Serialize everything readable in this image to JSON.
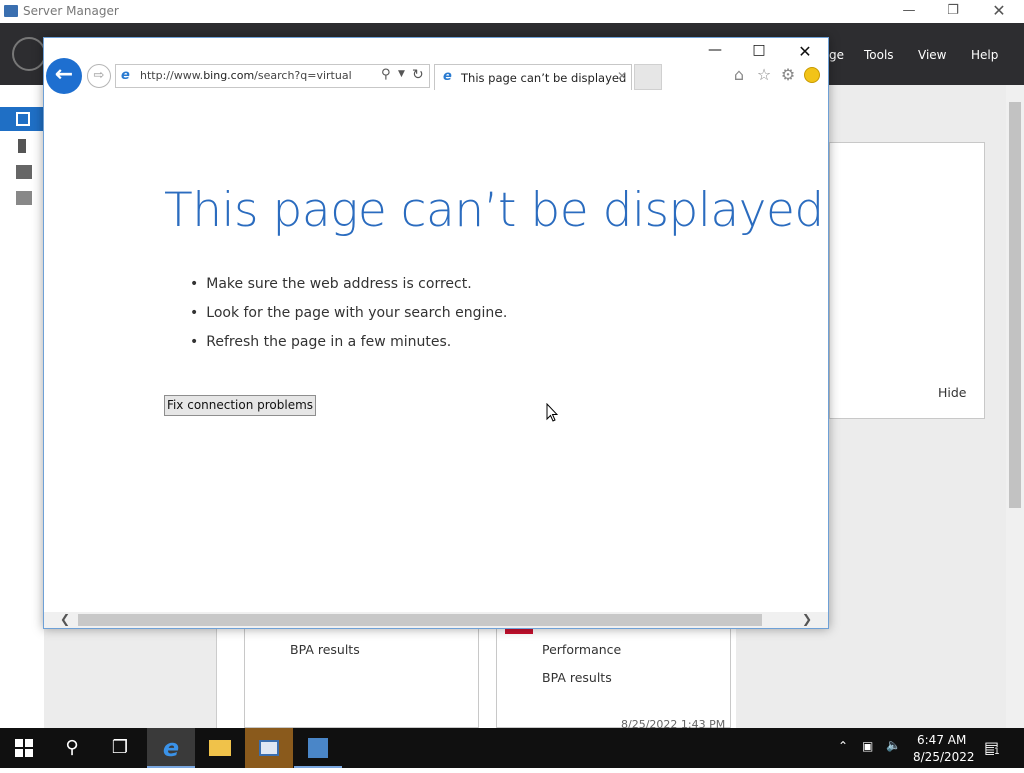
{
  "server_manager": {
    "title": "Server Manager",
    "menu": {
      "manage": "ge",
      "tools": "Tools",
      "view": "View",
      "help": "Help"
    },
    "panel_hide": "Hide",
    "tiles": [
      {
        "items": [
          "BPA results"
        ]
      },
      {
        "items": [
          "Performance",
          "BPA results"
        ],
        "timestamp": "8/25/2022 1:43 PM"
      }
    ]
  },
  "browser": {
    "url_prefix": "http://www.",
    "url_domain": "bing.com",
    "url_rest": "/search?q=virtualbox+",
    "tab_title": "This page can’t be displayed",
    "error": {
      "heading": "This page can’t be displayed",
      "bullets": [
        "Make sure the web address is correct.",
        "Look for the page with your search engine.",
        "Refresh the page in a few minutes."
      ],
      "fix_button": "Fix connection problems"
    }
  },
  "taskbar": {
    "time": "6:47 AM",
    "date": "8/25/2022",
    "notification_count": "1"
  },
  "icons": [
    "server-manager-icon",
    "back-arrow-icon",
    "forward-arrow-icon",
    "ie-icon",
    "search-icon",
    "dropdown-icon",
    "refresh-icon",
    "close-tab-icon",
    "home-icon",
    "favorites-star-icon",
    "settings-gear-icon",
    "smiley-feedback-icon",
    "windows-start-icon",
    "search-taskbar-icon",
    "task-view-icon",
    "file-explorer-icon",
    "chevron-up-icon",
    "network-icon",
    "volume-muted-icon",
    "notifications-icon"
  ]
}
